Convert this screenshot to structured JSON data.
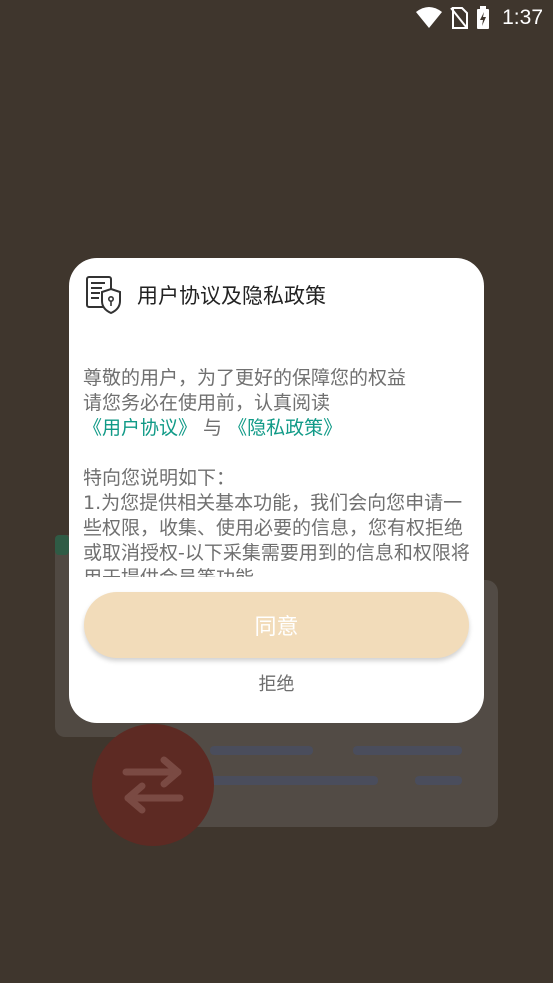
{
  "status_bar": {
    "time": "1:37",
    "icons": [
      "wifi-icon",
      "no-sim-icon",
      "battery-charging-icon"
    ]
  },
  "dialog": {
    "title": "用户协议及隐私政策",
    "icon": "privacy-document-shield-icon",
    "intro_line1": "尊敬的用户，为了更好的保障您的权益",
    "intro_line2": "请您务必在使用前，认真阅读",
    "user_agreement_link": "《用户协议》",
    "conjunction": " 与 ",
    "privacy_policy_link": "《隐私政策》",
    "notice_heading": "特向您说明如下：",
    "notice_body": "1.为您提供相关基本功能，我们会向您申请一些权限，收集、使用必要的信息，您有权拒绝或取消授权-以下采集需要用到的信息和权限将用于提供会员等功能",
    "agree_label": "同意",
    "reject_label": "拒绝"
  },
  "colors": {
    "overlay_background": "#3f362d",
    "dialog_background": "#ffffff",
    "link": "#109a87",
    "agree_button": "#f2dcba",
    "body_text": "#707070",
    "title_text": "#222222"
  }
}
